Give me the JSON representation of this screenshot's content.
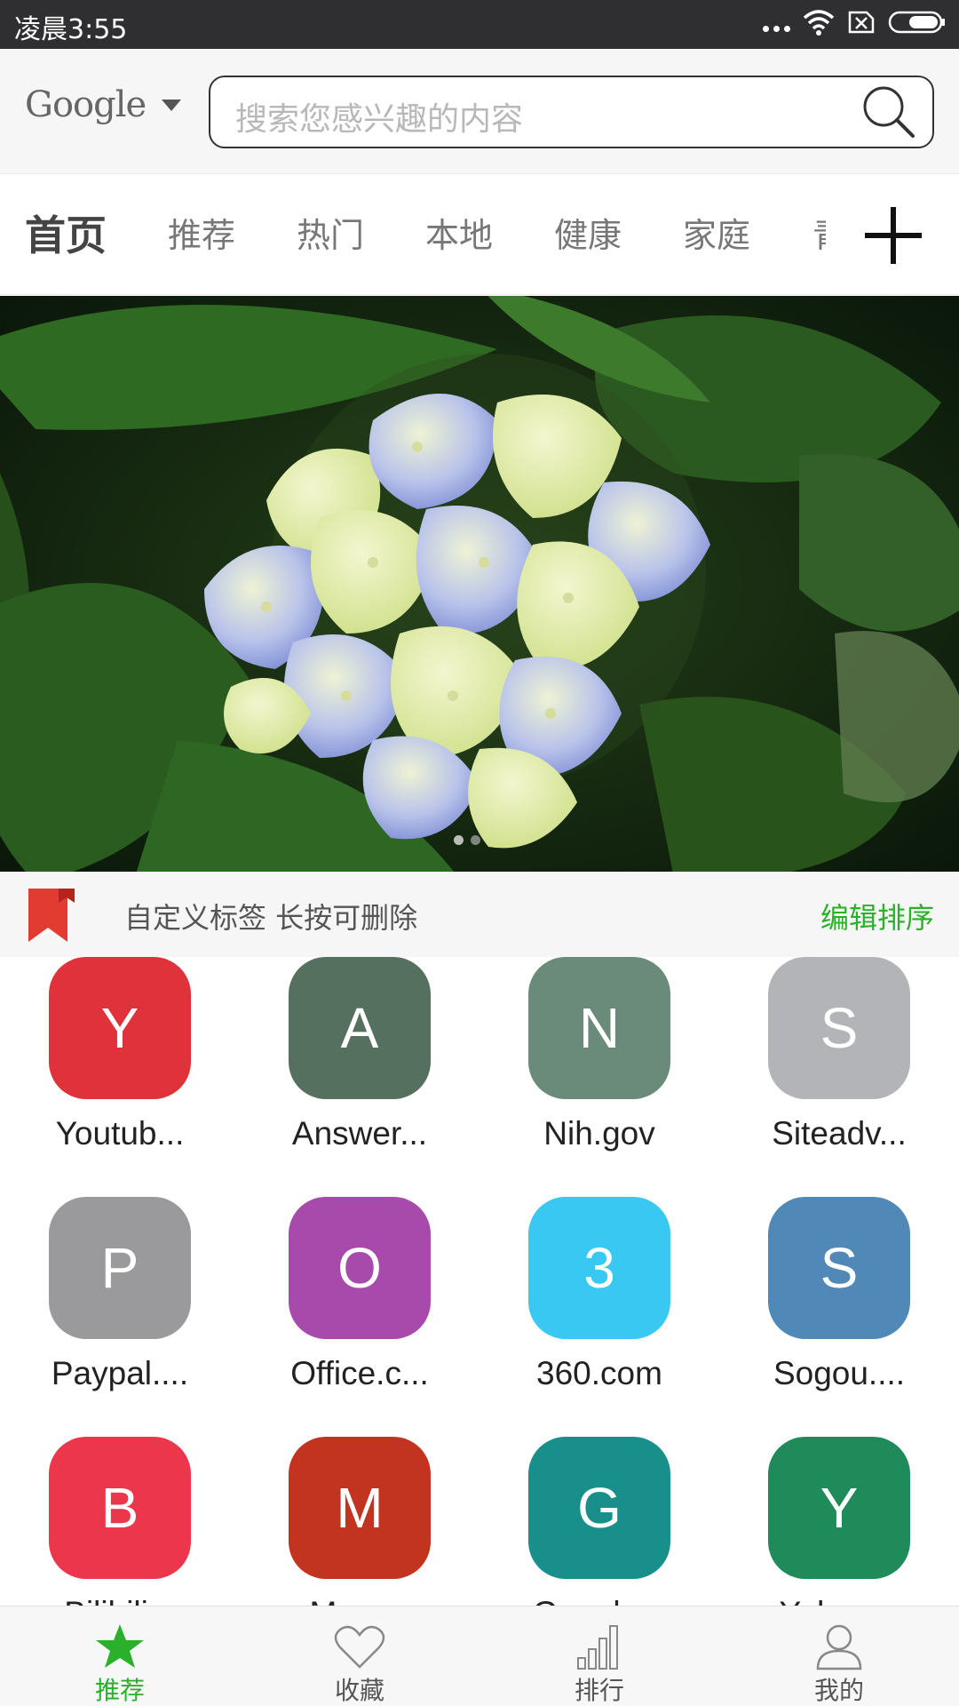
{
  "status_bar": {
    "time": "凌晨3:55",
    "icons": [
      "more-dots-icon",
      "wifi-icon",
      "sim-missing-icon",
      "battery-icon"
    ]
  },
  "search": {
    "engine": "Google",
    "placeholder": "搜索您感兴趣的内容"
  },
  "tabs": [
    {
      "label": "首页",
      "active": true
    },
    {
      "label": "推荐",
      "active": false
    },
    {
      "label": "热门",
      "active": false
    },
    {
      "label": "本地",
      "active": false
    },
    {
      "label": "健康",
      "active": false
    },
    {
      "label": "家庭",
      "active": false
    },
    {
      "label": "青",
      "active": false
    }
  ],
  "banner": {
    "description_icon": "hydrangea-photo",
    "page_count": 2,
    "active_page": 1
  },
  "bookmarks": {
    "hint": "自定义标签 长按可删除",
    "edit_label": "编辑排序"
  },
  "sites": [
    {
      "letter": "Y",
      "name": "Youtub...",
      "color": "#e0323b"
    },
    {
      "letter": "A",
      "name": "Answer...",
      "color": "#56705f"
    },
    {
      "letter": "N",
      "name": "Nih.gov",
      "color": "#6a8b79"
    },
    {
      "letter": "S",
      "name": "Siteadv...",
      "color": "#b3b4b7"
    },
    {
      "letter": "P",
      "name": "Paypal....",
      "color": "#9a9a9c"
    },
    {
      "letter": "O",
      "name": "Office.c...",
      "color": "#a84aac"
    },
    {
      "letter": "3",
      "name": "360.com",
      "color": "#38c8f2"
    },
    {
      "letter": "S",
      "name": "Sogou....",
      "color": "#5089b7"
    },
    {
      "letter": "B",
      "name": "Bilibili...",
      "color": "#ec364b"
    },
    {
      "letter": "M",
      "name": "Mom...",
      "color": "#c23420"
    },
    {
      "letter": "G",
      "name": "Google...",
      "color": "#188f8b"
    },
    {
      "letter": "Y",
      "name": "Yahoo...",
      "color": "#1f8b5a"
    }
  ],
  "bottom_nav": [
    {
      "label": "推荐",
      "icon": "star-icon",
      "active": true
    },
    {
      "label": "收藏",
      "icon": "heart-icon",
      "active": false
    },
    {
      "label": "排行",
      "icon": "bar-chart-icon",
      "active": false
    },
    {
      "label": "我的",
      "icon": "user-icon",
      "active": false
    }
  ],
  "colors": {
    "accent": "#2bb02b",
    "status_bar": "#2f2f31",
    "bookmark_red": "#e23b32"
  }
}
